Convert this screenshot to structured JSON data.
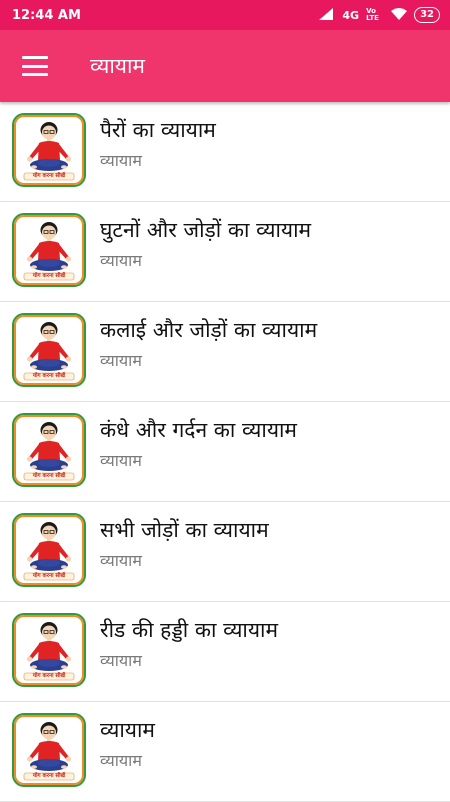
{
  "status": {
    "time": "12:44 AM",
    "network": "4G",
    "volte": "Vo LTE",
    "battery": "32"
  },
  "appbar": {
    "title": "व्यायाम"
  },
  "items": [
    {
      "title": "पैरों का व्यायाम",
      "subtitle": "व्यायाम",
      "caption": "योग करना सीखें"
    },
    {
      "title": "घुटनों और जोड़ों का व्यायाम",
      "subtitle": "व्यायाम",
      "caption": "योग करना सीखें"
    },
    {
      "title": "कलाई और जोड़ों का व्यायाम",
      "subtitle": "व्यायाम",
      "caption": "योग करना सीखें"
    },
    {
      "title": "कंधे और गर्दन का व्यायाम",
      "subtitle": "व्यायाम",
      "caption": "योग करना सीखें"
    },
    {
      "title": "सभी जोड़ों का व्यायाम",
      "subtitle": "व्यायाम",
      "caption": "योग करना सीखें"
    },
    {
      "title": "रीड की हड्डी का व्यायाम",
      "subtitle": "व्यायाम",
      "caption": "योग करना सीखें"
    },
    {
      "title": "व्यायाम",
      "subtitle": "व्यायाम",
      "caption": "योग करना सीखें"
    }
  ],
  "colors": {
    "statusbar": "#e8185f",
    "appbar": "#f0346c",
    "figure_shirt": "#e02424",
    "figure_pants": "#2a3f8f"
  }
}
